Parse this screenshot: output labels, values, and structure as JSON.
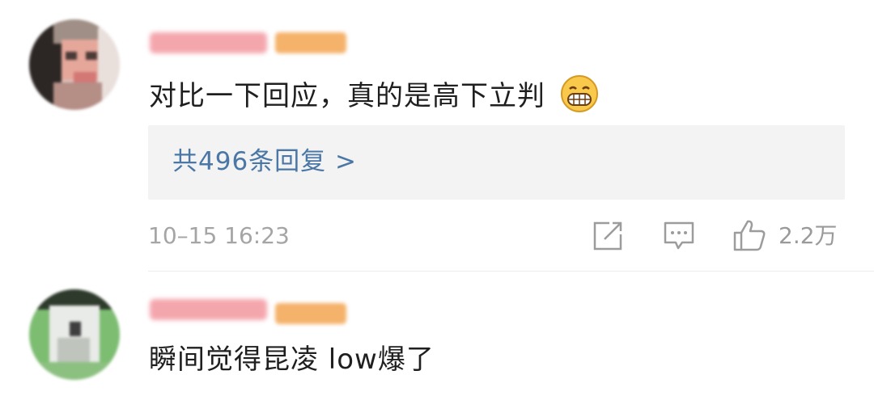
{
  "comments": [
    {
      "text": "对比一下回应，真的是高下立判",
      "emoji": "grinning-face-emoji",
      "replies_label": "共496条回复 >",
      "timestamp": "10–15 16:23",
      "like_count": "2.2万",
      "icons": [
        "share-icon",
        "comment-icon",
        "like-icon"
      ]
    },
    {
      "text": "瞬间觉得昆凌 low爆了"
    }
  ],
  "colors": {
    "link": "#4a77a5",
    "muted": "#a5a5a5",
    "reply_bg": "#f3f3f3",
    "badge": "#f5b26b"
  }
}
